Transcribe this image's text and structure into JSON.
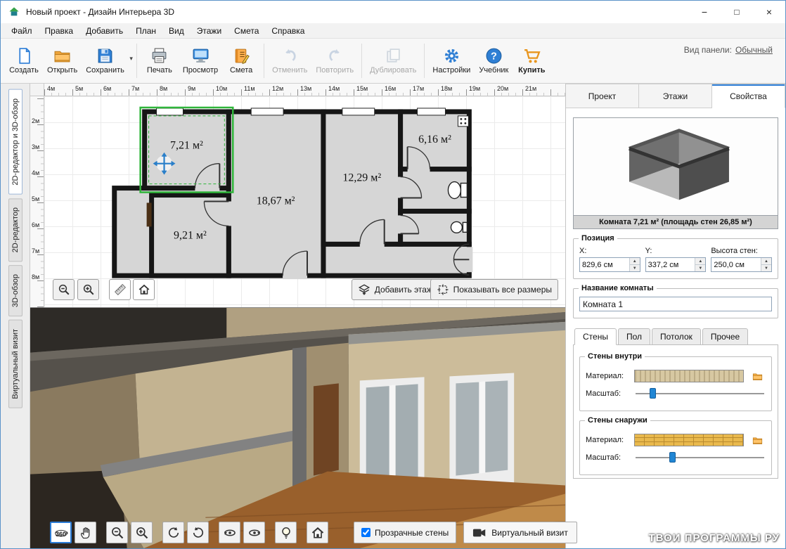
{
  "window": {
    "title": "Новый проект - Дизайн Интерьера 3D",
    "controls": {
      "minimize": "−",
      "maximize": "□",
      "close": "×"
    }
  },
  "menu": {
    "items": [
      "Файл",
      "Правка",
      "Добавить",
      "План",
      "Вид",
      "Этажи",
      "Смета",
      "Справка"
    ]
  },
  "toolbar": {
    "buttons": {
      "create": "Создать",
      "open": "Открыть",
      "save": "Сохранить",
      "print": "Печать",
      "preview": "Просмотр",
      "estimate": "Смета",
      "undo": "Отменить",
      "redo": "Повторить",
      "duplicate": "Дублировать",
      "settings": "Настройки",
      "tutorial": "Учебник",
      "buy": "Купить"
    },
    "panel_view": {
      "label": "Вид панели:",
      "value": "Обычный"
    }
  },
  "left_tabs": {
    "items": [
      "2D-редактор и 3D-обзор",
      "2D-редактор",
      "3D-обзор",
      "Виртуальный визит"
    ]
  },
  "ruler": {
    "h": [
      "4м",
      "5м",
      "6м",
      "7м",
      "8м",
      "9м",
      "10м",
      "11м",
      "12м",
      "13м",
      "14м",
      "15м",
      "16м",
      "17м",
      "18м",
      "19м",
      "20м",
      "21м"
    ],
    "v": [
      "2м",
      "3м",
      "4м",
      "5м",
      "6м",
      "7м",
      "8м"
    ]
  },
  "plan": {
    "rooms": [
      {
        "area": "7,21 м²"
      },
      {
        "area": "18,67 м²"
      },
      {
        "area": "12,29 м²"
      },
      {
        "area": "6,16 м²"
      },
      {
        "area": "9,21 м²"
      }
    ],
    "buttons": {
      "add_floor": "Добавить этаж",
      "show_dims": "Показывать все размеры"
    }
  },
  "viewer3d": {
    "buttons": {
      "mode360": "360"
    },
    "transparent_walls_label": "Прозрачные стены",
    "virtual_visit_label": "Виртуальный визит"
  },
  "right_panel": {
    "tabs": [
      "Проект",
      "Этажи",
      "Свойства"
    ],
    "preview_caption": "Комната 7,21 м²  (площадь стен 26,85 м²)",
    "position": {
      "title": "Позиция",
      "x_label": "X:",
      "x_value": "829,6 см",
      "y_label": "Y:",
      "y_value": "337,2 см",
      "height_label": "Высота стен:",
      "height_value": "250,0 см"
    },
    "room_name": {
      "title": "Название комнаты",
      "value": "Комната 1"
    },
    "material_tabs": [
      "Стены",
      "Пол",
      "Потолок",
      "Прочее"
    ],
    "walls_inner": {
      "title": "Стены внутри",
      "material_label": "Материал:",
      "scale_label": "Масштаб:"
    },
    "walls_outer": {
      "title": "Стены снаружи",
      "material_label": "Материал:",
      "scale_label": "Масштаб:"
    }
  },
  "icons": {
    "save_caret": "▾",
    "spin_up": "▲",
    "spin_down": "▼",
    "help_glyph": "?"
  },
  "watermark": "ТВОИ ПРОГРАММЫ РУ",
  "colors": {
    "accent_blue": "#2b7cd6",
    "selection_green": "#2fb53a",
    "buy_orange": "#e8951d"
  }
}
